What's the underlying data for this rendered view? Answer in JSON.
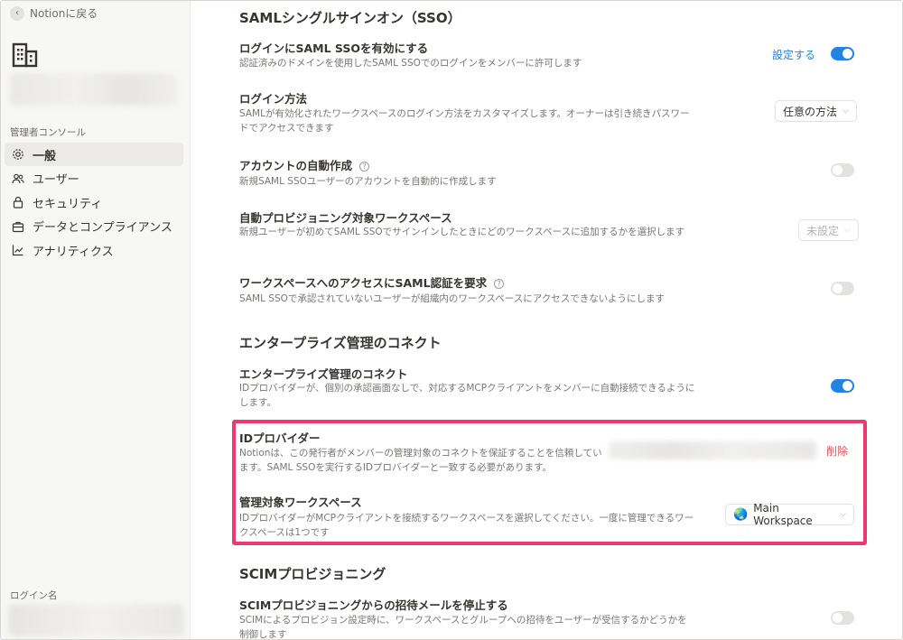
{
  "sidebar": {
    "back_label": "Notionに戻る",
    "section_label": "管理者コンソール",
    "items": [
      {
        "label": "一般",
        "icon": "gear-icon",
        "active": true
      },
      {
        "label": "ユーザー",
        "icon": "users-icon",
        "active": false
      },
      {
        "label": "セキュリティ",
        "icon": "lock-icon",
        "active": false
      },
      {
        "label": "データとコンプライアンス",
        "icon": "briefcase-icon",
        "active": false
      },
      {
        "label": "アナリティクス",
        "icon": "chart-icon",
        "active": false
      }
    ],
    "login_label": "ログイン名"
  },
  "saml": {
    "heading": "SAMLシングルサインオン（SSO）",
    "enable": {
      "title": "ログインにSAML SSOを有効にする",
      "desc": "認証済みのドメインを使用したSAML SSOでのログインをメンバーに許可します",
      "link": "設定する",
      "toggle": true
    },
    "login_method": {
      "title": "ログイン方法",
      "desc": "SAMLが有効化されたワークスペースのログイン方法をカスタマイズします。オーナーは引き続きパスワードでアクセスできます",
      "value": "任意の方法"
    },
    "auto_create": {
      "title": "アカウントの自動作成",
      "desc": "新規SAML SSOユーザーのアカウントを自動的に作成します",
      "toggle": false
    },
    "auto_provision": {
      "title": "自動プロビジョニング対象ワークスペース",
      "desc": "新規ユーザーが初めてSAML SSOでサインインしたときにどのワークスペースに追加するかを選択します",
      "value": "未設定"
    },
    "require_saml": {
      "title": "ワークスペースへのアクセスにSAML認証を要求",
      "desc": "SAML SSOで承認されていないユーザーが組織内のワークスペースにアクセスできないようにします",
      "toggle": false
    }
  },
  "enterprise": {
    "heading": "エンタープライズ管理のコネクト",
    "connect": {
      "title": "エンタープライズ管理のコネクト",
      "desc": "IDプロバイダーが、個別の承認画面なしで、対応するMCPクライアントをメンバーに自動接続できるようにします。",
      "toggle": true
    },
    "idp": {
      "title": "IDプロバイダー",
      "desc": "Notionは、この発行者がメンバーの管理対象のコネクトを保証することを信頼しています。SAML SSOを実行するIDプロバイダーと一致する必要があります。",
      "delete_label": "削除"
    },
    "managed_ws": {
      "title": "管理対象ワークスペース",
      "desc": "IDプロバイダーがMCPクライアントを接続するワークスペースを選択してください。一度に管理できるワークスペースは1つです",
      "value": "Main Workspace",
      "icon": "globe-icon"
    }
  },
  "scim": {
    "heading": "SCIMプロビジョニング",
    "stop_invites": {
      "title": "SCIMプロビジョニングからの招待メールを停止する",
      "desc": "SCIMによるプロビジョン設定時に、ワークスペースとグループへの招待をユーザーが受信するかどうかを制御します",
      "toggle": false
    }
  },
  "colors": {
    "accent": "#2383e2",
    "danger": "#eb5757",
    "highlight": "#ea3a6e"
  }
}
